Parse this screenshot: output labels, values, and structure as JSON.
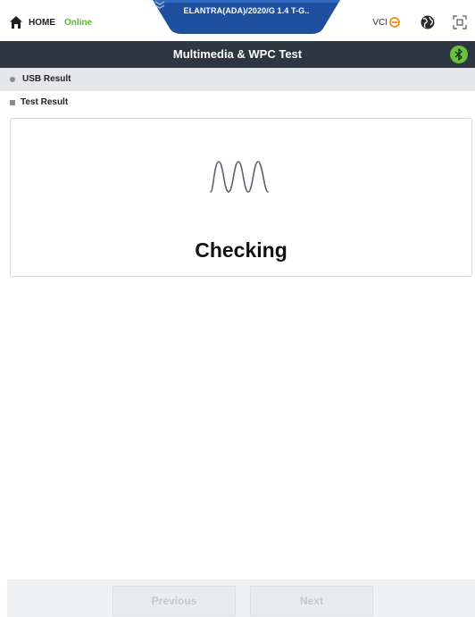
{
  "header": {
    "home_label": "HOME",
    "status_label": "Online",
    "vehicle_label": "ELANTRA(ADA)/2020/G 1.4 T-G..",
    "vci_label": "VCI",
    "icons": {
      "home": "home-icon",
      "vehicle_expand": "chevron-down-icon",
      "vci_status": "disconnected-status-icon",
      "globe": "globe-icon",
      "capture": "screen-capture-icon"
    },
    "colors": {
      "online": "#5bb82e",
      "vehicle_tab": "#1f4f9f",
      "vci_status": "#f08a17"
    }
  },
  "title_bar": {
    "title": "Multimedia & WPC Test",
    "icon": "bluetooth-icon",
    "icon_color": "#66c33a",
    "background": "#2d3641"
  },
  "sections": {
    "usb_result_label": "USB Result",
    "test_result_label": "Test Result"
  },
  "result_panel": {
    "icon": "waveform-icon",
    "status_text": "Checking"
  },
  "footer": {
    "previous_label": "Previous",
    "next_label": "Next"
  }
}
